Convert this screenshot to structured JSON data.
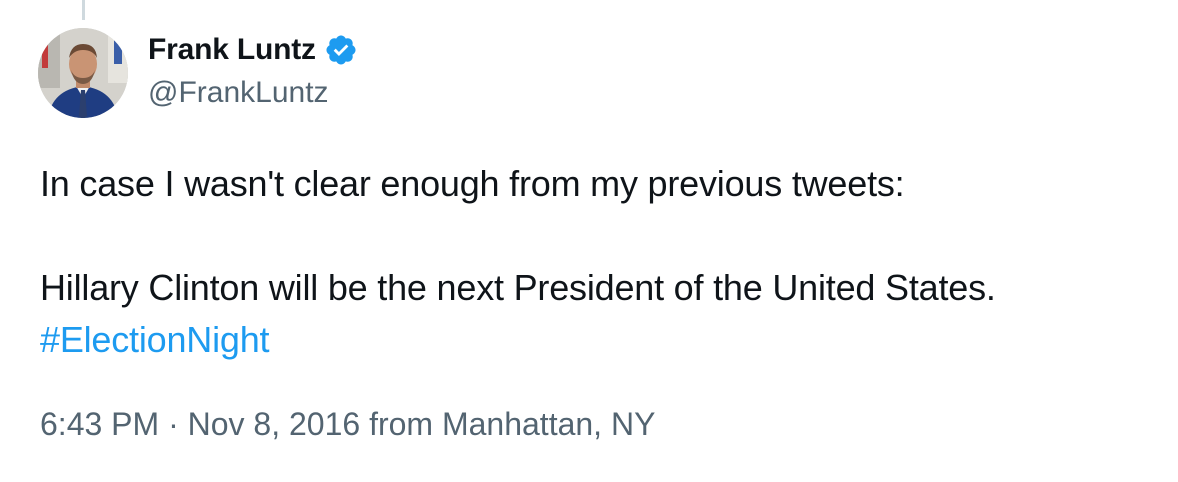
{
  "author": {
    "display_name": "Frank Luntz",
    "handle": "@FrankLuntz",
    "verified": true,
    "avatar_icon": "profile-photo"
  },
  "tweet": {
    "line1": "In case I wasn't clear enough from my previous tweets:",
    "line2": "Hillary Clinton will be the next President of the United States.",
    "hashtag": "#ElectionNight"
  },
  "meta": {
    "time": "6:43 PM",
    "separator": "·",
    "date": "Nov 8, 2016",
    "source": "from Manhattan, NY"
  },
  "colors": {
    "text": "#0f1419",
    "secondary": "#536471",
    "link": "#1d9bf0",
    "verified": "#1d9bf0"
  }
}
